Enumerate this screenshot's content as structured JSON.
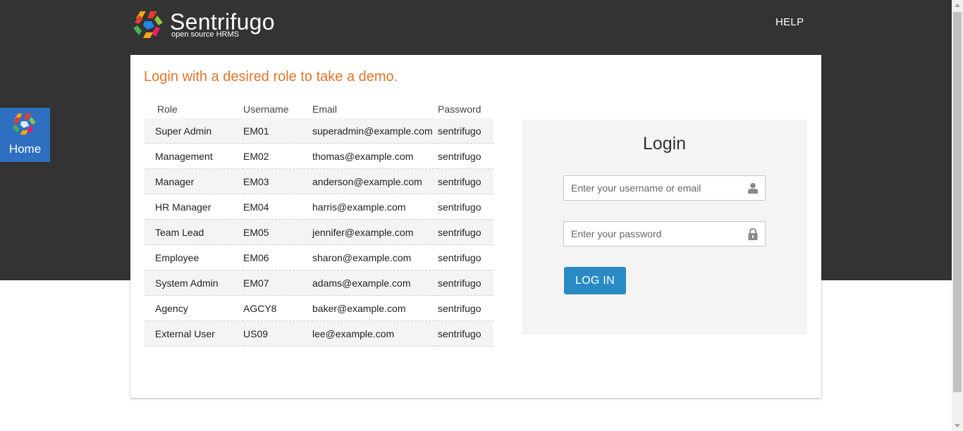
{
  "header": {
    "brand": "Sentrifugo",
    "tagline": "open source HRMS",
    "help_label": "HELP"
  },
  "sidebar": {
    "home_label": "Home"
  },
  "demo": {
    "title": "Login with a desired role to take a demo.",
    "columns": [
      "Role",
      "Username",
      "Email",
      "Password"
    ],
    "rows": [
      {
        "role": "Super Admin",
        "username": "EM01",
        "email": "superadmin@example.com",
        "password": "sentrifugo"
      },
      {
        "role": "Management",
        "username": "EM02",
        "email": "thomas@example.com",
        "password": "sentrifugo"
      },
      {
        "role": "Manager",
        "username": "EM03",
        "email": "anderson@example.com",
        "password": "sentrifugo"
      },
      {
        "role": "HR Manager",
        "username": "EM04",
        "email": "harris@example.com",
        "password": "sentrifugo"
      },
      {
        "role": "Team Lead",
        "username": "EM05",
        "email": "jennifer@example.com",
        "password": "sentrifugo"
      },
      {
        "role": "Employee",
        "username": "EM06",
        "email": "sharon@example.com",
        "password": "sentrifugo"
      },
      {
        "role": "System Admin",
        "username": "EM07",
        "email": "adams@example.com",
        "password": "sentrifugo"
      },
      {
        "role": "Agency",
        "username": "AGCY8",
        "email": "baker@example.com",
        "password": "sentrifugo"
      },
      {
        "role": "External User",
        "username": "US09",
        "email": "lee@example.com",
        "password": "sentrifugo"
      }
    ]
  },
  "login": {
    "title": "Login",
    "username_placeholder": "Enter your username or email",
    "username_value": "",
    "password_placeholder": "Enter your password",
    "password_value": "",
    "button_label": "LOG IN",
    "user_icon": "user-icon",
    "lock_icon": "lock-icon"
  },
  "colors": {
    "header_bg": "#333333",
    "accent_orange": "#e0752a",
    "button_blue": "#2a8bc4",
    "home_tab_blue": "#2f6fc0"
  }
}
